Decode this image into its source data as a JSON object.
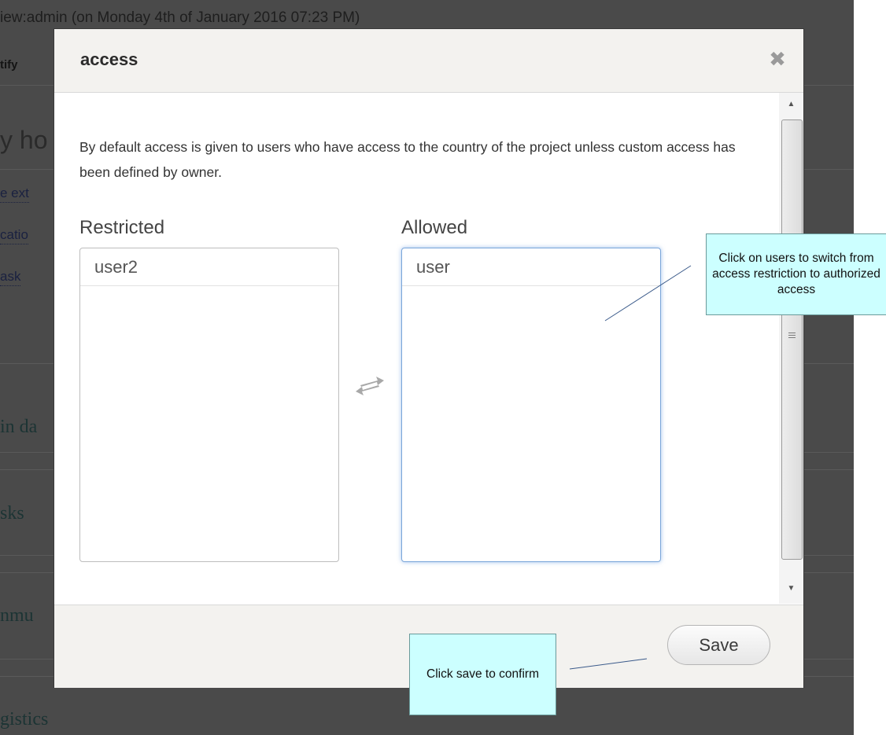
{
  "background_page": {
    "header_text": "iew:admin (on Monday 4th of January 2016 07:23 PM)",
    "notify_text": "tify",
    "heading_fragment": "y ho",
    "links": [
      "e ext",
      "catio",
      "ask"
    ],
    "sections": [
      "in da",
      "sks",
      "nmu",
      "gistics"
    ]
  },
  "dialog": {
    "title": "access",
    "close_icon": "close-icon",
    "description": "By default access is given to users who have access to the country of the project unless custom access has been defined by owner.",
    "restricted": {
      "label": "Restricted",
      "users": [
        "user2"
      ]
    },
    "allowed": {
      "label": "Allowed",
      "users": [
        "user"
      ]
    },
    "swap_icon": "swap-arrows-icon",
    "save_label": "Save"
  },
  "callouts": {
    "users": "Click on users to switch from access restriction to authorized access",
    "save": "Click save to confirm"
  },
  "colors": {
    "overlay": "#4a4a4a",
    "callout_fill": "#ccffff",
    "focus_border": "#7aa6da"
  }
}
